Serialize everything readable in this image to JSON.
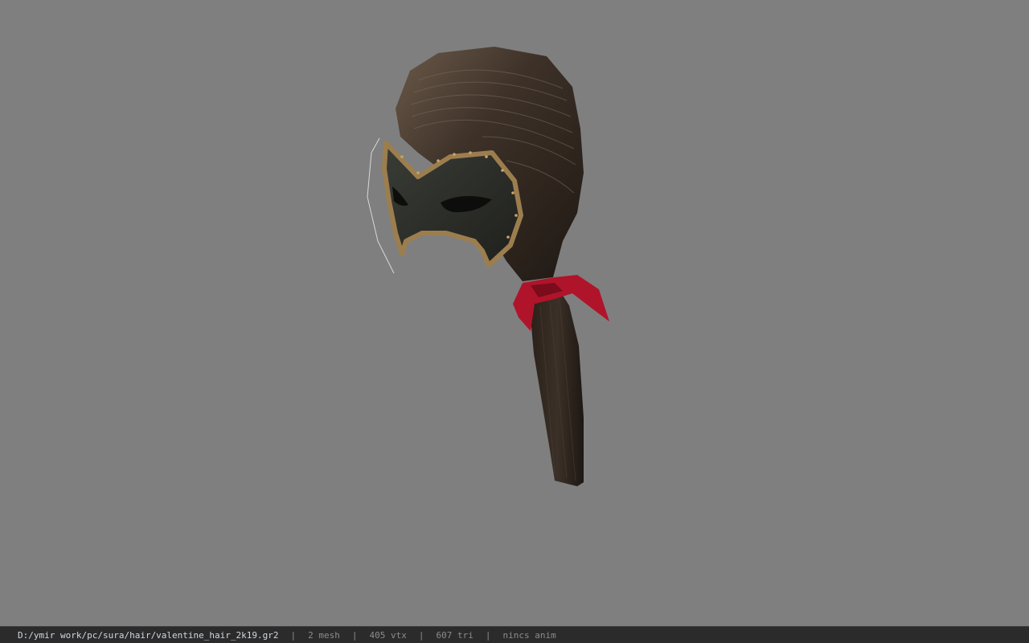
{
  "viewport": {
    "background_color": "#7f7f7f",
    "model": {
      "description_icon": "hair-model-icon",
      "hair_color": "#3a2e25",
      "mask_color": "#2e2f2a",
      "mask_trim_color": "#9c7e4e",
      "ribbon_color": "#b0142a"
    }
  },
  "statusbar": {
    "file_path": "D:/ymir work/pc/sura/hair/valentine_hair_2k19.gr2",
    "separator": "|",
    "mesh_count": "2 mesh",
    "vertex_count": "405 vtx",
    "triangle_count": "607 tri",
    "anim_status": "nincs anim"
  }
}
